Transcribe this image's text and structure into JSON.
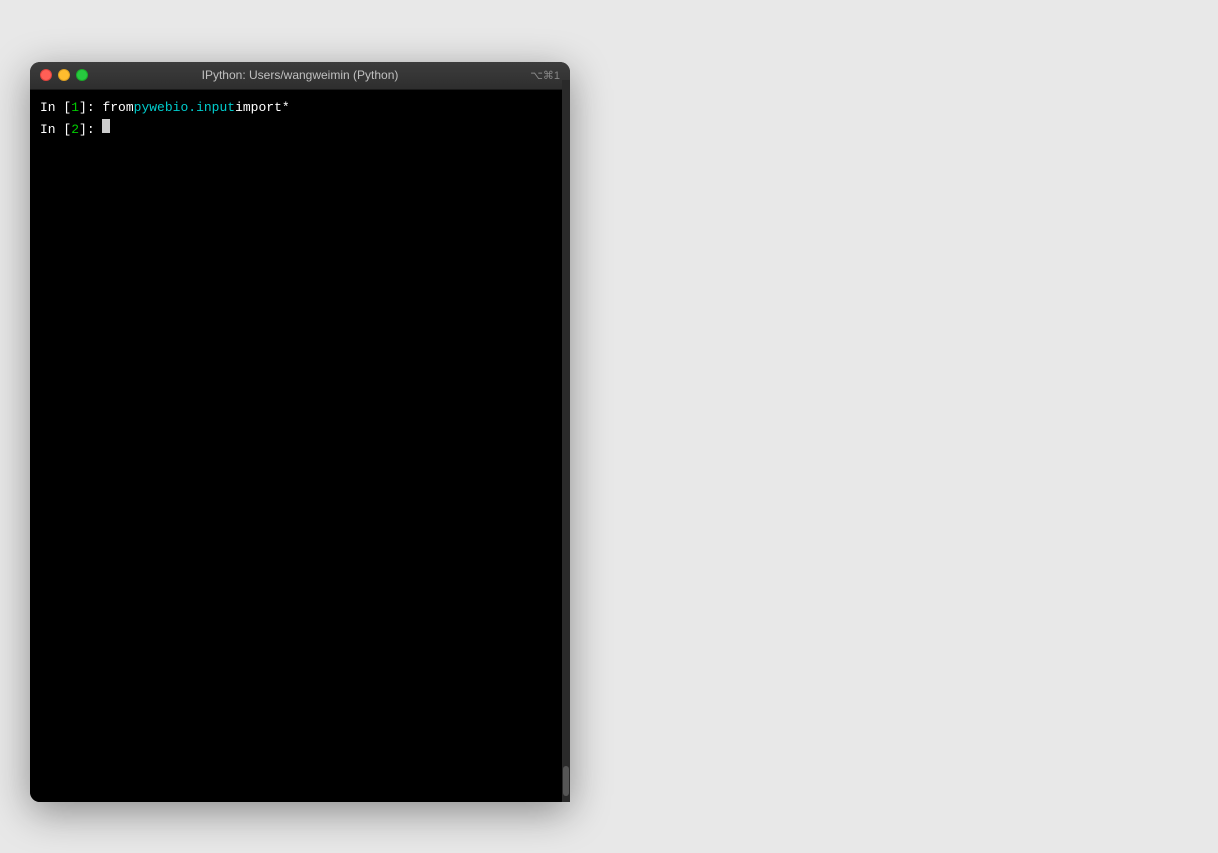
{
  "window": {
    "titlebar": {
      "title": "IPython: Users/wangweimin (Python)",
      "shortcut": "⌥⌘1",
      "close_label": "close",
      "minimize_label": "minimize",
      "maximize_label": "maximize"
    },
    "terminal": {
      "lines": [
        {
          "prompt_in": "In [",
          "prompt_num": "1",
          "prompt_close": "]:",
          "code_from": " from ",
          "code_module": "pywebio.input",
          "code_import": " import ",
          "code_star": "*",
          "has_cursor": false
        },
        {
          "prompt_in": "In [",
          "prompt_num": "2",
          "prompt_close": "]:",
          "code_from": "",
          "code_module": "",
          "code_import": "",
          "code_star": "",
          "has_cursor": true
        }
      ]
    }
  }
}
